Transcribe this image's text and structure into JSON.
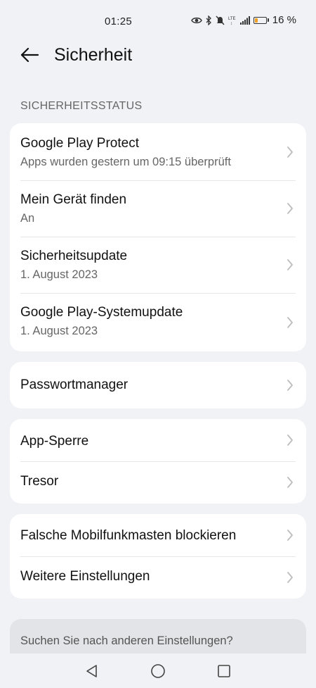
{
  "status_bar": {
    "time": "01:25",
    "battery_text": "16 %",
    "battery_level": 0.16,
    "icons": [
      "eye-icon",
      "bluetooth-icon",
      "mute-icon",
      "lte-icon",
      "signal-icon",
      "battery-icon"
    ]
  },
  "header": {
    "title": "Sicherheit",
    "back_icon": "arrow-left-icon"
  },
  "section": {
    "label": "SICHERHEITSSTATUS"
  },
  "card1": {
    "items": [
      {
        "title": "Google Play Protect",
        "subtitle": "Apps wurden gestern um 09:15 überprüft"
      },
      {
        "title": "Mein Gerät finden",
        "subtitle": "An"
      },
      {
        "title": "Sicherheitsupdate",
        "subtitle": "1. August 2023"
      },
      {
        "title": "Google Play-Systemupdate",
        "subtitle": "1. August 2023"
      }
    ]
  },
  "card2": {
    "items": [
      {
        "title": "Passwortmanager"
      }
    ]
  },
  "card3": {
    "items": [
      {
        "title": "App-Sperre"
      },
      {
        "title": "Tresor"
      }
    ]
  },
  "card4": {
    "items": [
      {
        "title": "Falsche Mobilfunkmasten blockieren"
      },
      {
        "title": "Weitere Einstellungen"
      }
    ]
  },
  "search": {
    "text": "Suchen Sie nach anderen Einstellungen?"
  },
  "nav": {
    "icons": [
      "back-triangle-icon",
      "home-circle-icon",
      "recents-square-icon"
    ]
  },
  "colors": {
    "background": "#f1f2f6",
    "card": "#ffffff",
    "primary_text": "#111111",
    "secondary_text": "#666666",
    "chevron": "#bdbdbd",
    "battery_fill": "#f0a020"
  }
}
